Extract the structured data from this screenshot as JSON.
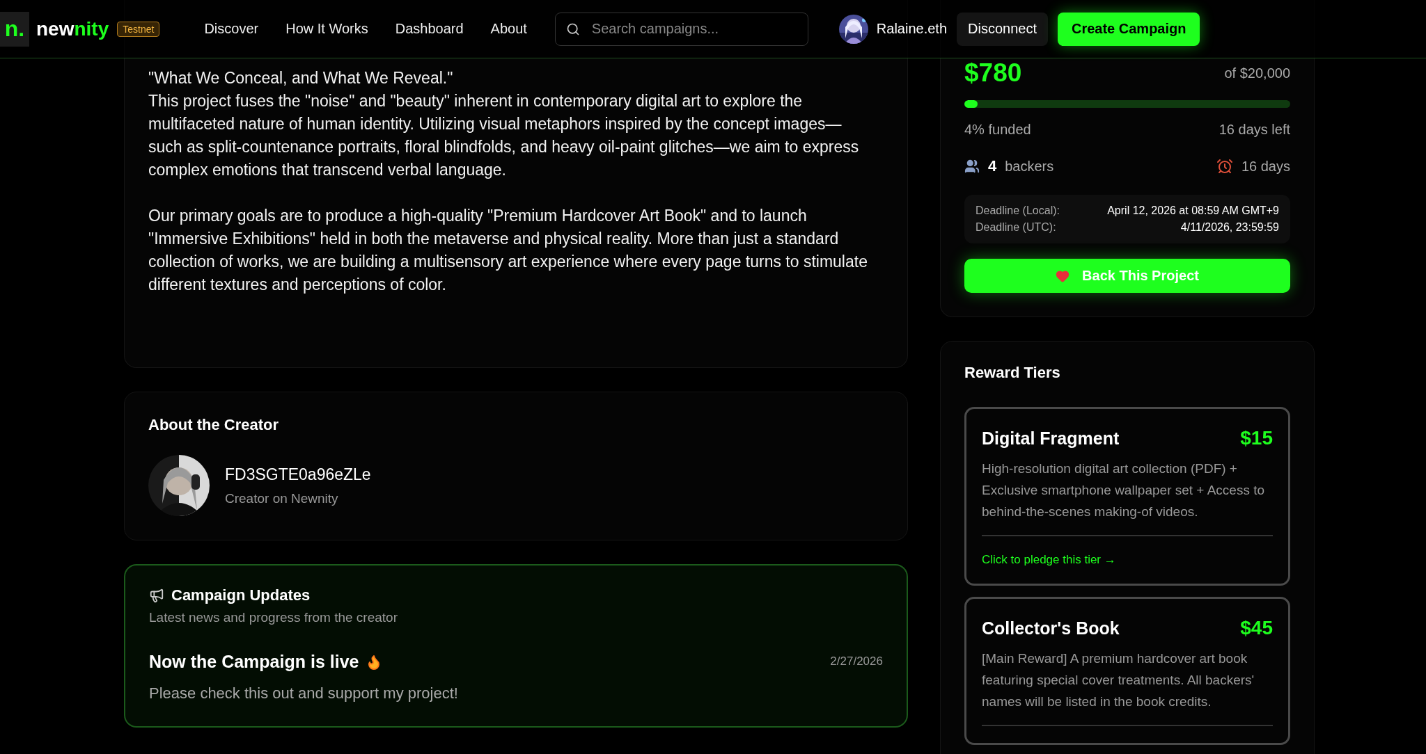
{
  "header": {
    "logo": {
      "mark": "n.",
      "name_start": "new",
      "name_end": "nity"
    },
    "badge": "Testnet",
    "nav": [
      {
        "label": "Discover"
      },
      {
        "label": "How It Works"
      },
      {
        "label": "Dashboard"
      },
      {
        "label": "About"
      }
    ],
    "search": {
      "placeholder": "Search campaigns..."
    },
    "user": {
      "name": "Ralaine.eth"
    },
    "disconnect": "Disconnect",
    "create": "Create Campaign"
  },
  "about": {
    "blocks": [
      {
        "lines": [
          "\"What We Conceal, and What We Reveal.\"",
          "This project fuses the \"noise\" and \"beauty\" inherent in contemporary digital art to explore the multifaceted nature of human identity. Utilizing visual metaphors inspired by the concept images—such as split-countenance portraits, floral blindfolds, and heavy oil-paint glitches—we aim to express complex emotions that transcend verbal language."
        ]
      },
      {
        "lines": [
          "Our primary goals are to produce a high-quality \"Premium Hardcover Art Book\" and to launch \"Immersive Exhibitions\" held in both the metaverse and physical reality. More than just a standard collection of works, we are building a multisensory art experience where every page turns to stimulate different textures and perceptions of color."
        ]
      }
    ]
  },
  "creator": {
    "title": "About the Creator",
    "name": "FD3SGTE0a96eZLe",
    "role": "Creator on Newnity"
  },
  "updates": {
    "title": "Campaign Updates",
    "subtitle": "Latest news and progress from the creator",
    "items": [
      {
        "title": "Now the Campaign is live",
        "date": "2/27/2026",
        "body": "Please check this out and support my project!"
      }
    ]
  },
  "funding": {
    "raised": "$780",
    "goal": "of $20,000",
    "level": 0.04,
    "funded": "4% funded",
    "time_left": "16 days left",
    "backers_count": "4",
    "backers_label": "backers",
    "days": "16 days",
    "deadlines": [
      {
        "label": "Deadline (Local):",
        "value": "April 12, 2026 at 08:59 AM GMT+9"
      },
      {
        "label": "Deadline (UTC):",
        "value": "4/11/2026, 23:59:59"
      }
    ],
    "back_button": "Back This Project"
  },
  "rewards": {
    "title": "Reward Tiers",
    "tiers": [
      {
        "title": "Digital Fragment",
        "price": "$15",
        "description": "High-resolution digital art collection (PDF) + Exclusive smartphone wallpaper set + Access to behind-the-scenes making-of videos.",
        "pledge": "Click to pledge this tier →"
      },
      {
        "title": "Collector's Book",
        "price": "$45",
        "description": "[Main Reward] A premium hardcover art book featuring special cover treatments. All backers' names will be listed in the book credits."
      }
    ]
  }
}
